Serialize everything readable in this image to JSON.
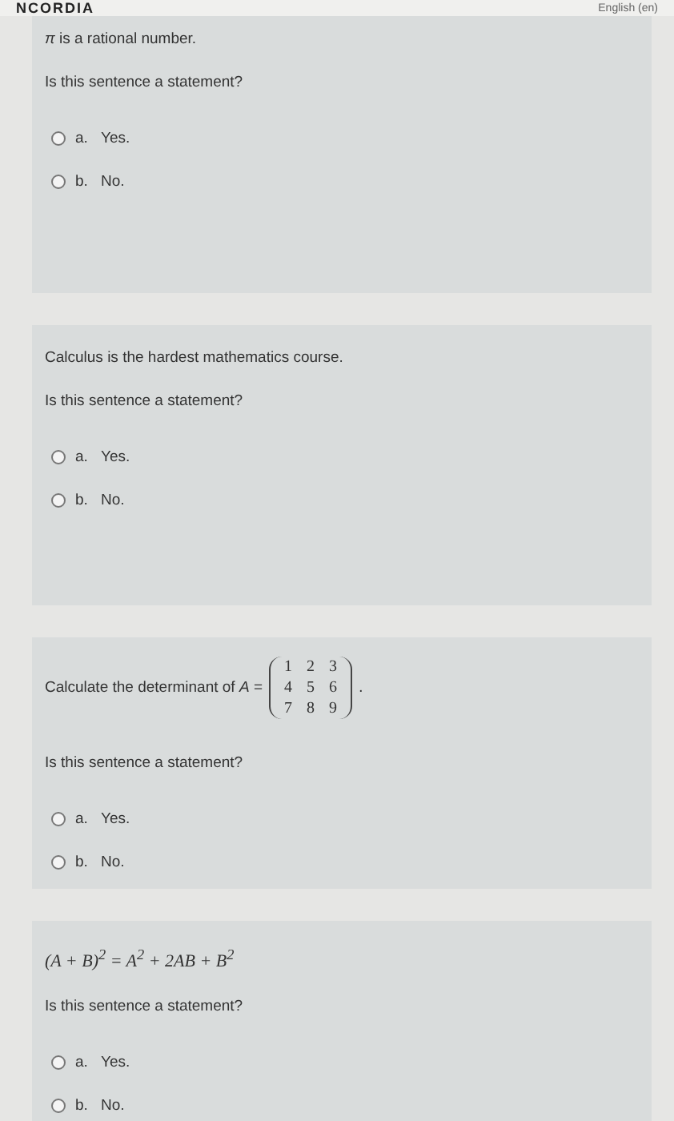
{
  "header": {
    "logo": "NCORDIA",
    "language": "English (en)"
  },
  "questions": [
    {
      "kind": "text",
      "text": "*π* is a rational number.",
      "prompt": "Is this sentence a statement?",
      "options": [
        {
          "letter": "a.",
          "label": "Yes.",
          "selected": false
        },
        {
          "letter": "b.",
          "label": "No.",
          "selected": false
        }
      ]
    },
    {
      "kind": "text",
      "text": "Calculus is the hardest mathematics course.",
      "prompt": "Is this sentence a statement?",
      "options": [
        {
          "letter": "a.",
          "label": "Yes.",
          "selected": false
        },
        {
          "letter": "b.",
          "label": "No.",
          "selected": false
        }
      ]
    },
    {
      "kind": "matrix",
      "text": "Calculate the determinant of *A* =",
      "matrix": [
        [
          "1",
          "2",
          "3"
        ],
        [
          "4",
          "5",
          "6"
        ],
        [
          "7",
          "8",
          "9"
        ]
      ],
      "suffix": ".",
      "prompt": "Is this sentence a statement?",
      "options": [
        {
          "letter": "a.",
          "label": "Yes.",
          "selected": false
        },
        {
          "letter": "b.",
          "label": "No.",
          "selected": false
        }
      ]
    },
    {
      "kind": "formula",
      "text": "(A + B)$^{2}$ = A$^{2}$ + 2AB + B$^{2}$",
      "prompt": "Is this sentence a statement?",
      "options": [
        {
          "letter": "a.",
          "label": "Yes.",
          "selected": false
        },
        {
          "letter": "b.",
          "label": "No.",
          "selected": false
        }
      ]
    }
  ]
}
